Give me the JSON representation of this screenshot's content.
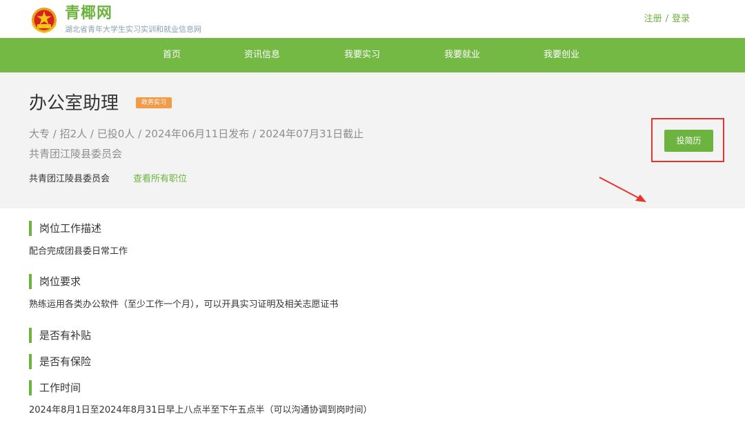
{
  "header": {
    "brand_name": "青椰网",
    "brand_sub": "湖北省青年大学生实习实训和就业信息网",
    "register_label": "注册",
    "auth_separator": "/",
    "login_label": "登录"
  },
  "nav": {
    "items": [
      {
        "label": "首页"
      },
      {
        "label": "资讯信息"
      },
      {
        "label": "我要实习"
      },
      {
        "label": "我要就业"
      },
      {
        "label": "我要创业"
      }
    ]
  },
  "job": {
    "title": "办公室助理",
    "tag": "政务实习",
    "meta": "大专 / 招2人 / 已投0人 / 2024年06月11日发布 / 2024年07月31日截止",
    "org_line": "共青团江陵县委员会",
    "company": "共青团江陵县委员会",
    "view_all_label": "查看所有职位",
    "apply_label": "投简历"
  },
  "sections": [
    {
      "heading": "岗位工作描述",
      "text": "配合完成团县委日常工作"
    },
    {
      "heading": "岗位要求",
      "text": "熟练运用各类办公软件（至少工作一个月），可以开具实习证明及相关志愿证书"
    },
    {
      "heading": "是否有补贴",
      "text": ""
    },
    {
      "heading": "是否有保险",
      "text": ""
    },
    {
      "heading": "工作时间",
      "text": "2024年8月1日至2024年8月31日早上八点半至下午五点半（可以沟通协调到岗时间）"
    }
  ],
  "colors": {
    "brand_green": "#73b944",
    "tag_orange": "#f39b47",
    "highlight_red": "#e8322b"
  }
}
